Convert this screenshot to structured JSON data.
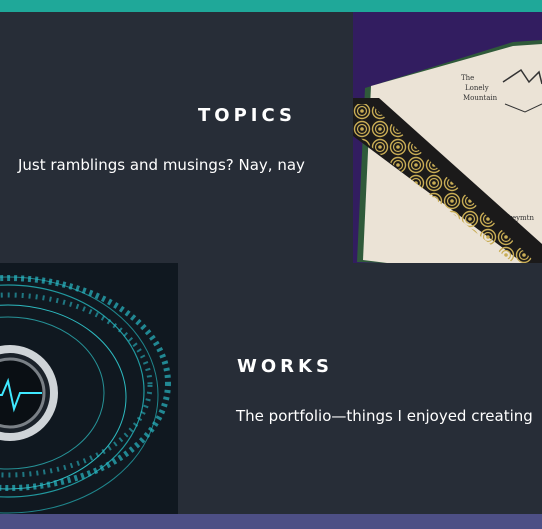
{
  "topics": {
    "heading": "TOPICS",
    "description": "Just ramblings and musings? Nay, nay",
    "image_icon": "map-bookmark-image"
  },
  "works": {
    "heading": "WORKS",
    "description": "The portfolio—things I enjoyed creating",
    "image_icon": "binary-ring-image"
  },
  "colors": {
    "accent_top": "#1fa899",
    "accent_bottom": "#4d4f85",
    "panel_bg": "#272d37",
    "text": "#ffffff"
  }
}
